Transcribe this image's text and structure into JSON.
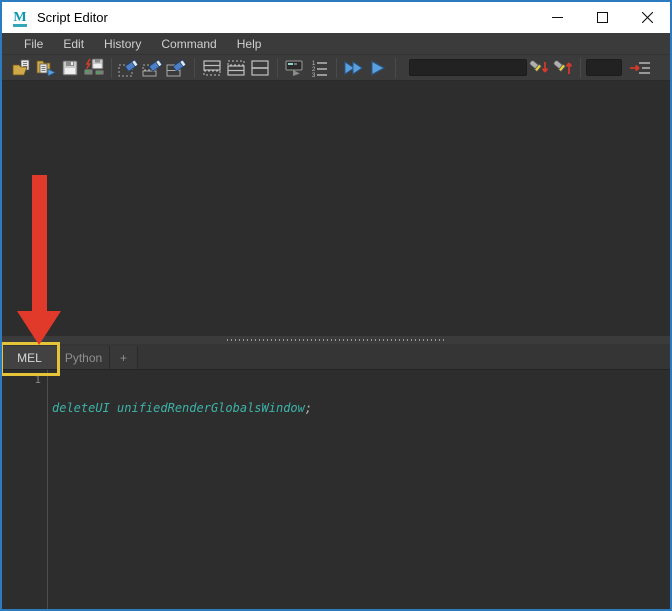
{
  "window": {
    "title": "Script Editor",
    "controls": {
      "minimize": "minimize",
      "maximize": "maximize",
      "close": "close"
    }
  },
  "menu": {
    "items": [
      {
        "label": "File"
      },
      {
        "label": "Edit"
      },
      {
        "label": "History"
      },
      {
        "label": "Command"
      },
      {
        "label": "Help"
      }
    ]
  },
  "toolbar": {
    "icons": [
      "open-script-icon",
      "load-script-icon",
      "save-script-icon",
      "save-to-shelf-icon",
      "clear-history-icon",
      "clear-input-icon",
      "clear-all-icon",
      "pane-input-only-icon",
      "pane-history-only-icon",
      "pane-split-icon",
      "echo-commands-icon",
      "line-numbers-icon",
      "execute-all-icon",
      "execute-icon",
      "search-down-icon",
      "search-up-icon",
      "goto-line-icon"
    ],
    "search": {
      "value": "",
      "placeholder": ""
    },
    "goto_line": {
      "value": "",
      "placeholder": ""
    }
  },
  "tabs": [
    {
      "label": "MEL",
      "active": true
    },
    {
      "label": "Python",
      "active": false
    },
    {
      "label": "+",
      "active": false
    }
  ],
  "editor": {
    "line_number": "1",
    "code": {
      "command": "deleteUI",
      "separator": " ",
      "argument": "unifiedRenderGlobalsWindow",
      "terminator": ";"
    }
  },
  "annotations": {
    "arrow_color": "#e23a2a",
    "highlight_box_color": "#e6c437"
  },
  "colors": {
    "window_border": "#2c7bbe",
    "titlebar_bg": "#ffffff",
    "chrome_bg": "#3b3b3b",
    "pane_bg": "#2d2d2d",
    "code_teal": "#3db3a8",
    "maya_logo_teal": "#0c99ae"
  }
}
